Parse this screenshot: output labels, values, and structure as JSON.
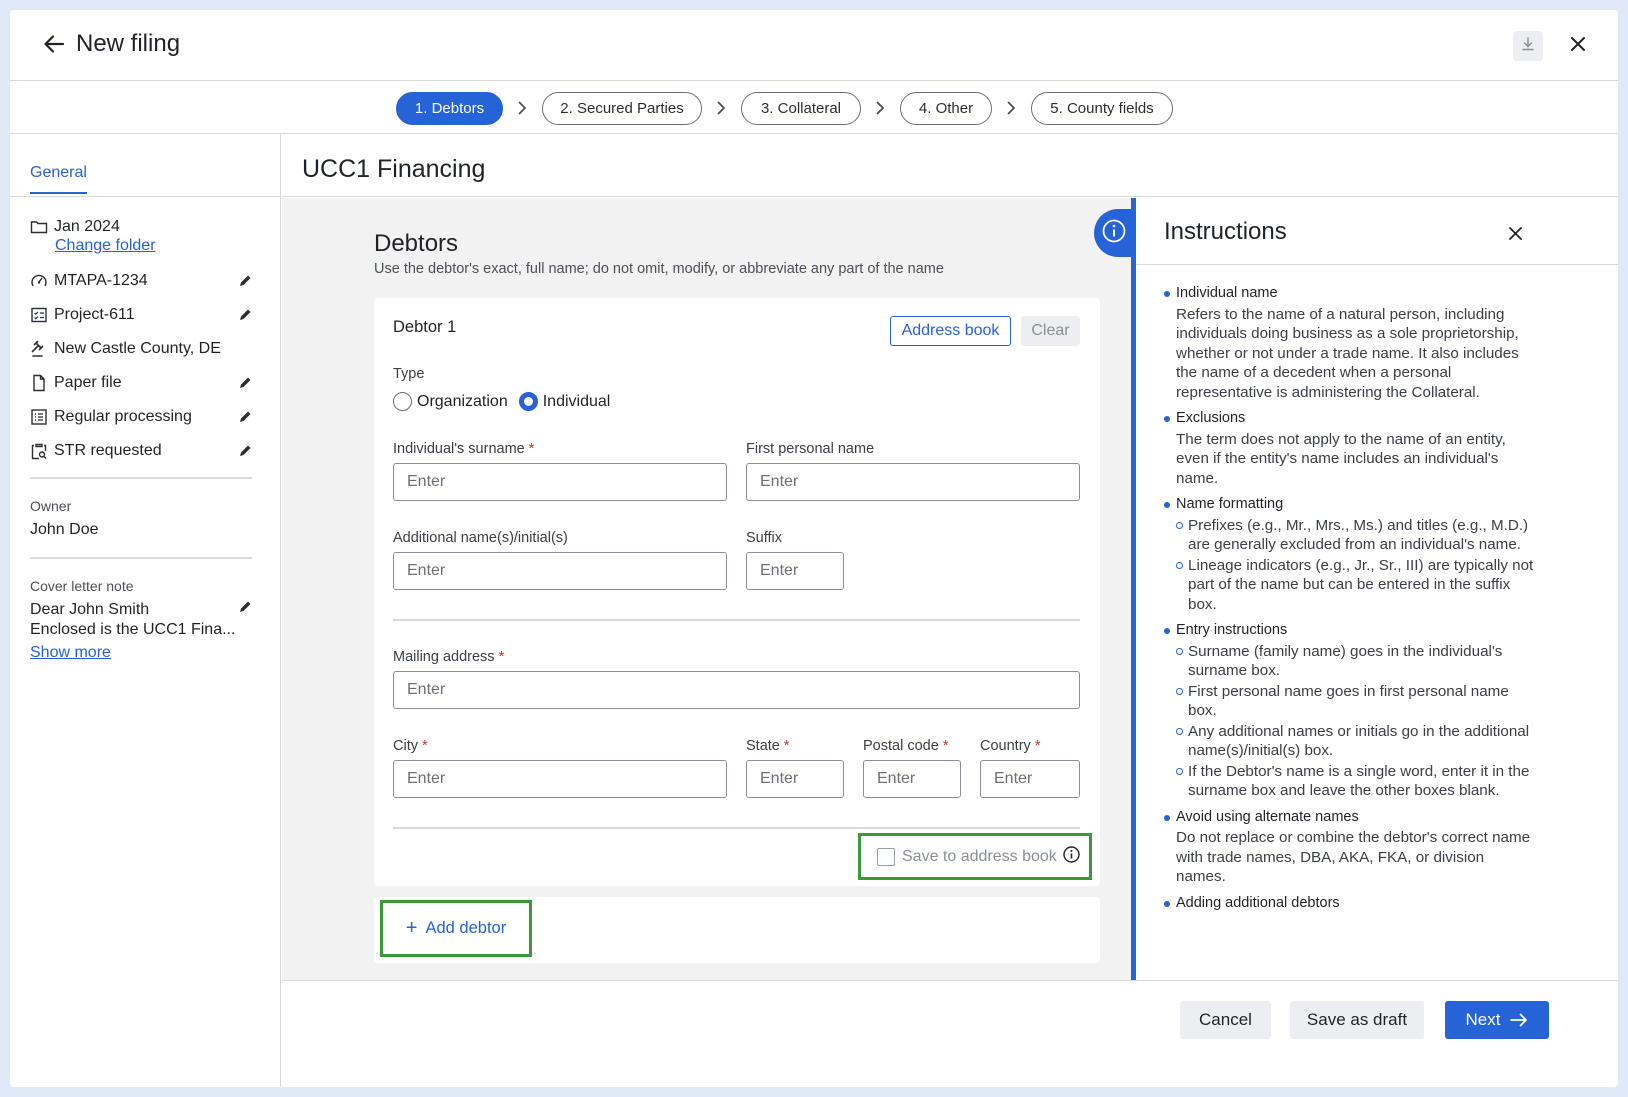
{
  "window": {
    "title": "New filing"
  },
  "steps": [
    "1.  Debtors",
    "2.  Secured Parties",
    "3.  Collateral",
    "4.  Other",
    "5.  County fields"
  ],
  "sidebar": {
    "tab": "General",
    "folder": "Jan 2024",
    "change_folder": "Change folder",
    "items": [
      "MTAPA-1234",
      "Project-611",
      "New Castle County, DE",
      "Paper file",
      "Regular processing",
      "STR requested"
    ],
    "owner_label": "Owner",
    "owner_value": "John Doe",
    "cover_label": "Cover letter note",
    "cover_line1": "Dear John Smith",
    "cover_line2": "Enclosed is the UCC1 Fina...",
    "show_more": "Show more"
  },
  "main": {
    "title": "UCC1 Financing"
  },
  "debtors": {
    "title": "Debtors",
    "subtitle": "Use the debtor's exact, full name; do not omit, modify, or abbreviate any part of the name",
    "card_title": "Debtor 1",
    "address_book": "Address book",
    "clear": "Clear",
    "type_label": "Type",
    "type_options": [
      "Organization",
      "Individual"
    ],
    "selected_type": "Individual",
    "surname_label": "Individual's surname",
    "first_name_label": "First personal name",
    "additional_label": "Additional name(s)/initial(s)",
    "suffix_label": "Suffix",
    "mailing_label": "Mailing address",
    "city_label": "City",
    "state_label": "State",
    "postal_label": "Postal code",
    "country_label": "Country",
    "required_mark": "*",
    "placeholder": "Enter",
    "save_to_address_book": "Save to address book",
    "add_debtor": "Add debtor"
  },
  "instructions": {
    "title": "Instructions",
    "sections": [
      {
        "heading": "Individual name",
        "text": "Refers to the name of a natural person, including individuals doing business as a sole proprietorship, whether or not under a trade name. It also includes the name of a decedent when a personal representative is administering the Collateral."
      },
      {
        "heading": "Exclusions",
        "text": "The term does not apply to the name of an entity, even if the entity's name includes an individual's name."
      },
      {
        "heading": "Name formatting",
        "subs": [
          "Prefixes (e.g., Mr., Mrs., Ms.) and titles (e.g., M.D.) are generally excluded from an individual's name.",
          "Lineage indicators (e.g., Jr., Sr., III) are typically not part of the name but can be entered in the suffix box."
        ]
      },
      {
        "heading": "Entry instructions",
        "subs": [
          "Surname (family name) goes in the individual's surname box.",
          "First personal name goes in first personal name box.",
          "Any additional names or initials go in the additional name(s)/initial(s) box.",
          "If the Debtor's name is a single word, enter it in the surname box and leave the other boxes blank."
        ]
      },
      {
        "heading": "Avoid using alternate names",
        "text": "Do not replace or combine the debtor's correct name with trade names, DBA, AKA, FKA, or division names."
      },
      {
        "heading": "Adding additional debtors",
        "text": ""
      }
    ]
  },
  "footer": {
    "cancel": "Cancel",
    "save_draft": "Save as draft",
    "next": "Next"
  }
}
